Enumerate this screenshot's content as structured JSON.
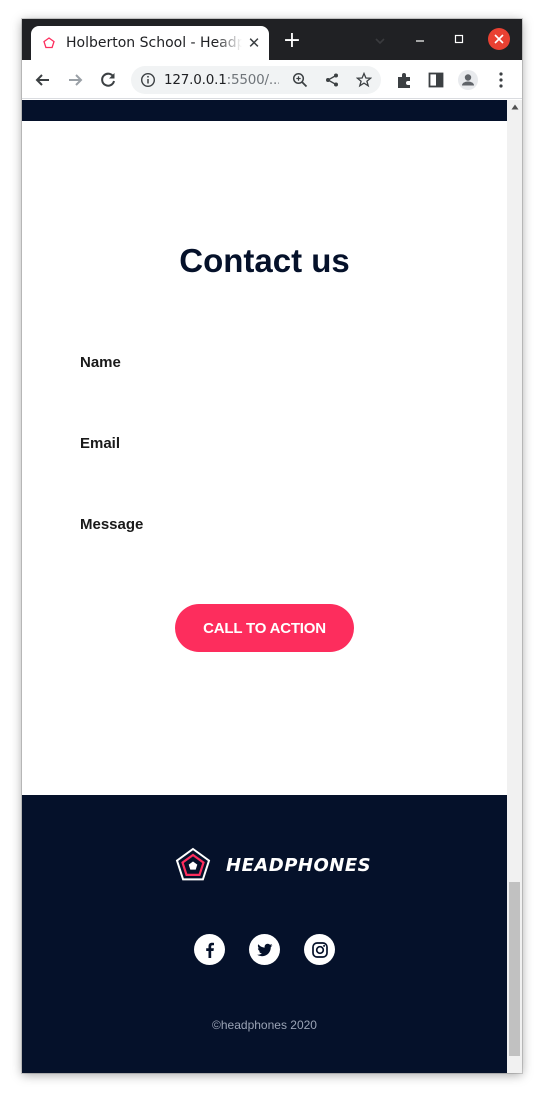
{
  "browser": {
    "tab_title": "Holberton School - Headphones",
    "url_host": "127.0.0.1",
    "url_rest": ":5500/...",
    "icons": [
      "favicon-pentagon-icon",
      "close-icon",
      "plus-icon",
      "tab-search-icon",
      "minimize-icon",
      "maximize-icon",
      "window-close-icon",
      "back-arrow-icon",
      "forward-arrow-icon",
      "reload-icon",
      "info-icon",
      "zoom-icon",
      "share-icon",
      "star-icon",
      "extensions-icon",
      "sidebar-icon",
      "profile-icon",
      "kebab-menu-icon"
    ]
  },
  "contact": {
    "title": "Contact us",
    "fields": [
      {
        "label": "Name"
      },
      {
        "label": "Email"
      },
      {
        "label": "Message"
      }
    ],
    "cta_label": "CALL TO ACTION"
  },
  "footer": {
    "brand": "HEADPHONES",
    "social": [
      "facebook-icon",
      "twitter-icon",
      "instagram-icon"
    ],
    "copyright": "©headphones 2020"
  },
  "colors": {
    "navy": "#05112a",
    "accent": "#fd2d5d",
    "chrome_dark": "#202124"
  }
}
